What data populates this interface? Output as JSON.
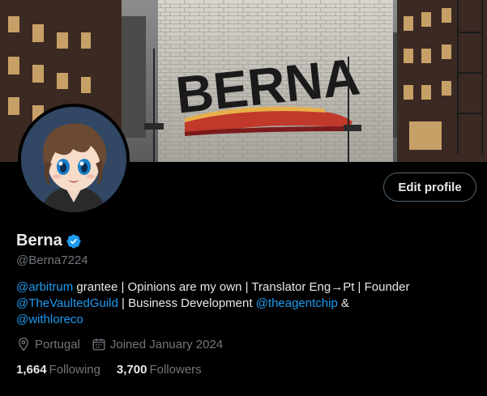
{
  "banner": {
    "sign_text": "BERNA",
    "sign_text_color": "#1a1a1a",
    "stripe_colors": [
      "#e8b04a",
      "#c0392b",
      "#7a1b1b"
    ]
  },
  "profile": {
    "display_name": "Berna",
    "handle": "@Berna7224",
    "verified": true,
    "edit_button_label": "Edit profile"
  },
  "bio": {
    "segments": [
      {
        "type": "mention",
        "text": "@arbitrum"
      },
      {
        "type": "text",
        "text": " grantee | Opinions are my own | Translator Eng→Pt | Founder "
      },
      {
        "type": "mention",
        "text": "@TheVaultedGuild"
      },
      {
        "type": "text",
        "text": " | Business Development "
      },
      {
        "type": "mention",
        "text": "@theagentchip"
      },
      {
        "type": "text",
        "text": " & "
      },
      {
        "type": "mention",
        "text": "@withloreco"
      }
    ]
  },
  "meta": {
    "location": "Portugal",
    "location_icon": "location-pin-icon",
    "joined": "Joined January 2024",
    "joined_icon": "calendar-icon"
  },
  "stats": {
    "following_count": "1,664",
    "following_label": "Following",
    "followers_count": "3,700",
    "followers_label": "Followers"
  },
  "colors": {
    "background": "#000000",
    "text_primary": "#e7e9ea",
    "text_secondary": "#71767b",
    "accent": "#1d9bf0",
    "border": "#536471"
  }
}
